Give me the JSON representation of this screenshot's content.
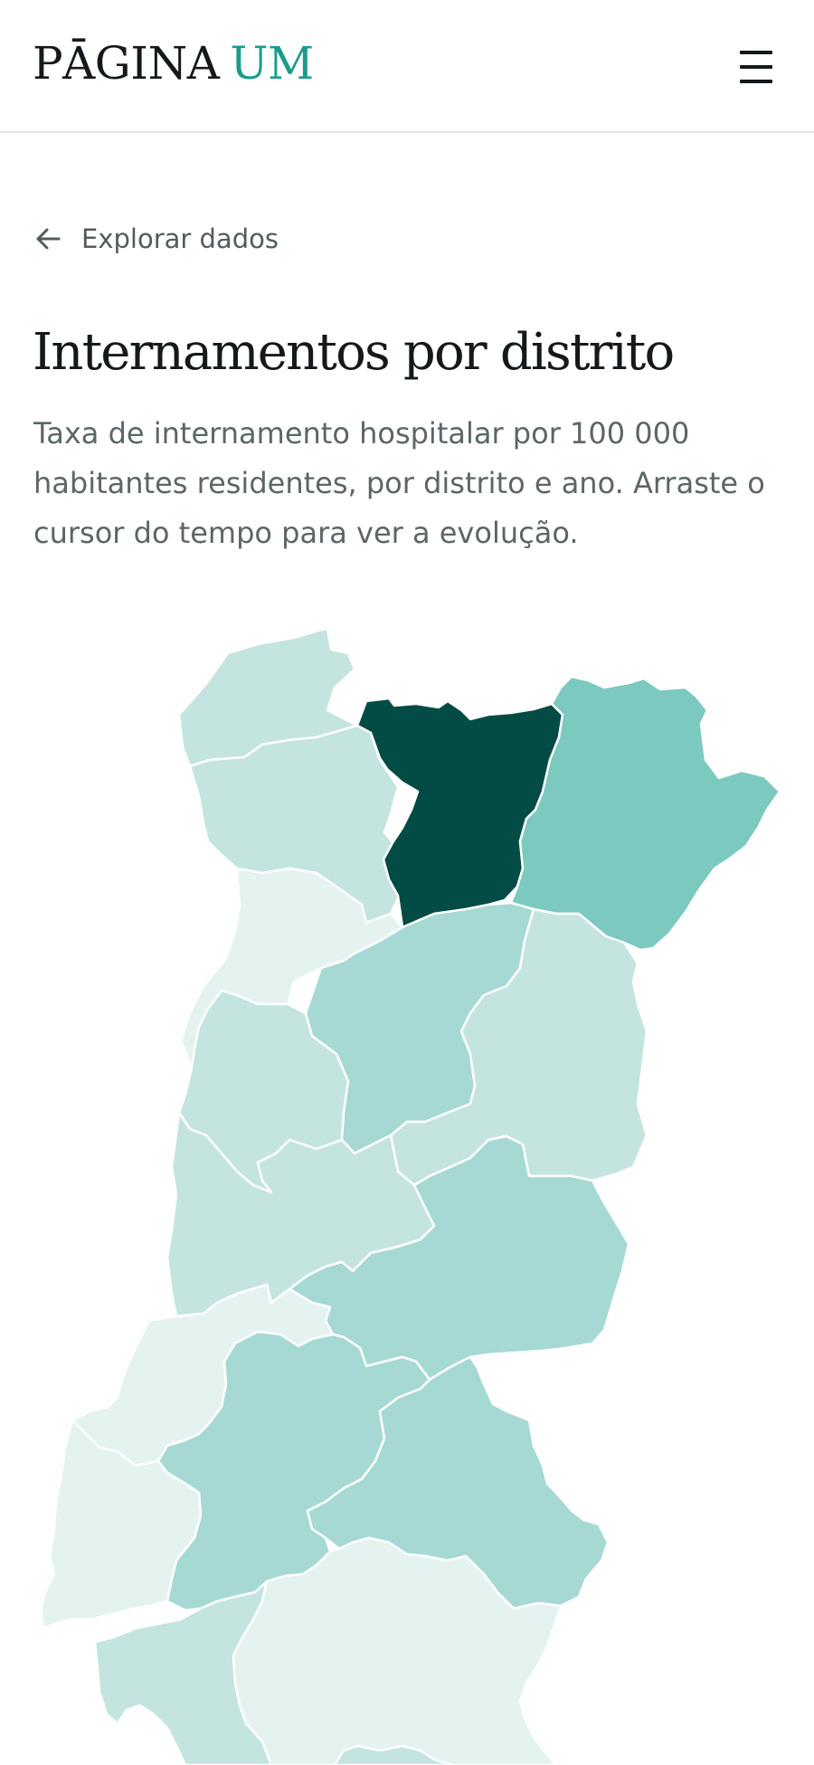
{
  "header": {
    "logo_word1": "PĀGINA",
    "logo_word2": "UM",
    "menu_icon": "hamburger-menu-icon"
  },
  "back_link": {
    "icon": "arrow-left-icon",
    "label": "Explorar dados"
  },
  "page": {
    "title": "Internamentos por distrito",
    "subtitle": "Taxa de internamento hospitalar por 100 000 habitantes residentes, por distrito e ano. Arraste o cursor do tempo para ver a evolução."
  },
  "map": {
    "colors": {
      "stroke": "#ffffff",
      "level_highest": "#034c45",
      "level_high": "#7cc9c0",
      "level_mid": "#a6d9d3",
      "level_low": "#c4e4e0",
      "level_lowest": "#e4f3f0"
    }
  }
}
